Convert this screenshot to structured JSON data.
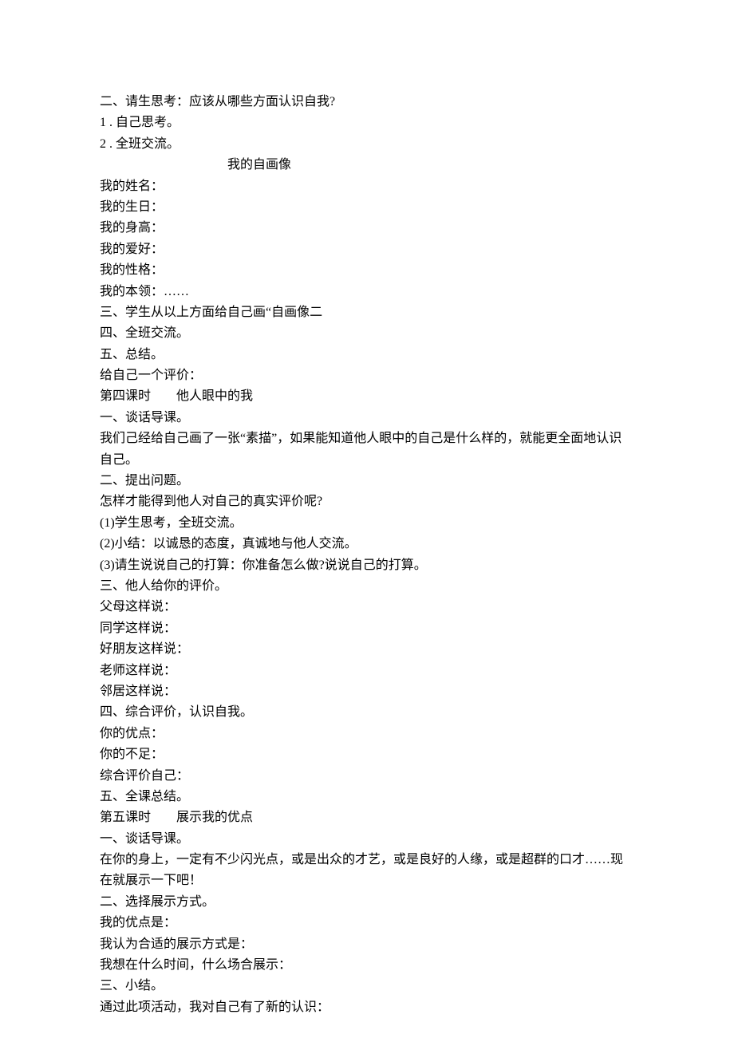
{
  "lines": [
    {
      "text": "二、请生思考：应该从哪些方面认识自我?",
      "class": ""
    },
    {
      "text": "1 . 自己思考。",
      "class": ""
    },
    {
      "text": "2  . 全班交流。",
      "class": ""
    },
    {
      "text": "我的自画像",
      "class": "indent-portrait"
    },
    {
      "text": "我的姓名：",
      "class": ""
    },
    {
      "text": "我的生日：",
      "class": ""
    },
    {
      "text": "我的身高：",
      "class": ""
    },
    {
      "text": "我的爱好：",
      "class": ""
    },
    {
      "text": "我的性格：",
      "class": ""
    },
    {
      "text": "我的本领：……",
      "class": ""
    },
    {
      "text": "三、学生从以上方面给自己画“自画像二",
      "class": ""
    },
    {
      "text": "四、全班交流。",
      "class": ""
    },
    {
      "text": "五、总结。",
      "class": ""
    },
    {
      "text": "给自己一个评价：",
      "class": ""
    },
    {
      "text": "第四课时　　他人眼中的我",
      "class": ""
    },
    {
      "text": "一、谈话导课。",
      "class": ""
    },
    {
      "text": "我们己经给自己画了一张“素描”，如果能知道他人眼中的自己是什么样的，就能更全面地认识自己。",
      "class": ""
    },
    {
      "text": "二、提出问题。",
      "class": ""
    },
    {
      "text": "怎样才能得到他人对自己的真实评价呢?",
      "class": ""
    },
    {
      "text": "(1)学生思考，全班交流。",
      "class": ""
    },
    {
      "text": "(2)小结：以诚恳的态度，真诚地与他人交流。",
      "class": ""
    },
    {
      "text": "(3)请生说说自己的打算：你准备怎么做?说说自己的打算。",
      "class": ""
    },
    {
      "text": "三、他人给你的评价。",
      "class": ""
    },
    {
      "text": "父母这样说：",
      "class": ""
    },
    {
      "text": "同学这样说：",
      "class": ""
    },
    {
      "text": "好朋友这样说：",
      "class": ""
    },
    {
      "text": "老师这样说：",
      "class": ""
    },
    {
      "text": "邻居这样说：",
      "class": ""
    },
    {
      "text": "四、综合评价，认识自我。",
      "class": ""
    },
    {
      "text": "你的优点：",
      "class": ""
    },
    {
      "text": "你的不足：",
      "class": ""
    },
    {
      "text": "综合评价自己：",
      "class": ""
    },
    {
      "text": "五、全课总结。",
      "class": ""
    },
    {
      "text": "第五课时　　展示我的优点",
      "class": ""
    },
    {
      "text": "一、谈话导课。",
      "class": ""
    },
    {
      "text": "在你的身上，一定有不少闪光点，或是出众的才艺，或是良好的人缘，或是超群的口才……现在就展示一下吧！",
      "class": ""
    },
    {
      "text": "二、选择展示方式。",
      "class": ""
    },
    {
      "text": "我的优点是：",
      "class": ""
    },
    {
      "text": "我认为合适的展示方式是：",
      "class": ""
    },
    {
      "text": "我想在什么时间，什么场合展示：",
      "class": ""
    },
    {
      "text": "三、小结。",
      "class": ""
    },
    {
      "text": "通过此项活动，我对自己有了新的认识：",
      "class": ""
    }
  ]
}
